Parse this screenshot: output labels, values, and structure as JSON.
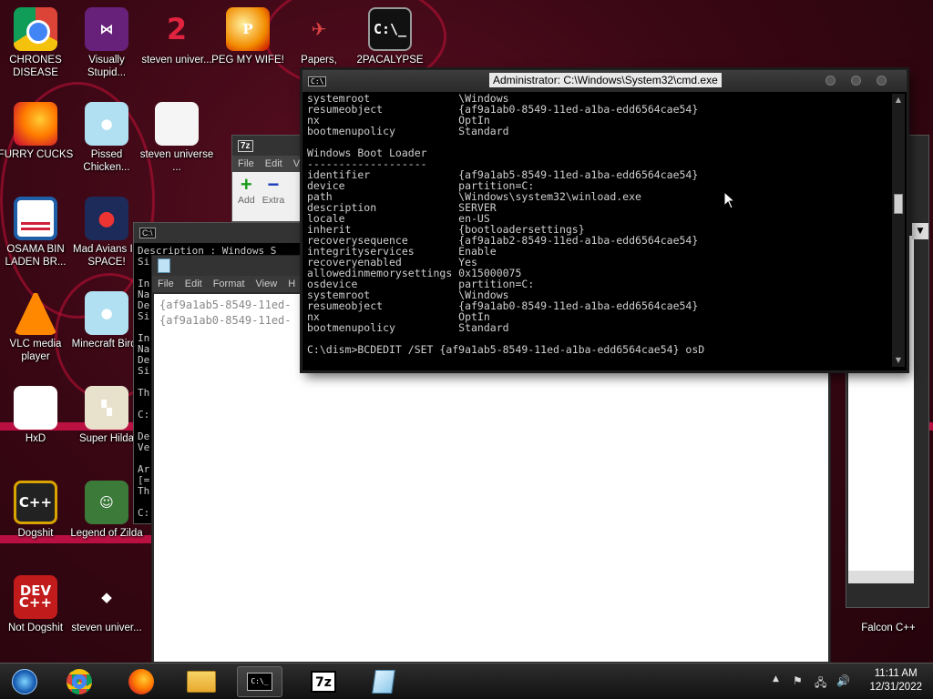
{
  "desktop_icons": [
    {
      "label": "CHRONES DISEASE",
      "icon": "chrome-icon"
    },
    {
      "label": "Visually Stupid...",
      "icon": "visual-studio-icon"
    },
    {
      "label": "steven univer...",
      "icon": "steven-universe-icon"
    },
    {
      "label": "PEG MY WIFE!",
      "icon": "p-icon"
    },
    {
      "label": "Papers,",
      "icon": "papers-please-icon"
    },
    {
      "label": "2PACALYPSE",
      "icon": "cmd-icon"
    },
    {
      "label": "FURRY CUCKS",
      "icon": "firefox-icon"
    },
    {
      "label": "Pissed Chicken...",
      "icon": "angry-birds-seasons-icon"
    },
    {
      "label": "steven universe ...",
      "icon": "document-icon"
    },
    {
      "label": "OSAMA BIN LADEN BR...",
      "icon": "obama-logo-icon"
    },
    {
      "label": "Mad Avians IN SPACE!",
      "icon": "angry-birds-space-icon"
    },
    {
      "label": "VLC media player",
      "icon": "vlc-icon"
    },
    {
      "label": "Minecraft Birds",
      "icon": "angry-birds-icon"
    },
    {
      "label": "HxD",
      "icon": "hxd-icon"
    },
    {
      "label": "Super Hilda",
      "icon": "pixel-art-icon"
    },
    {
      "label": "Dogshit",
      "icon": "dogshit-icon"
    },
    {
      "label": "Legend of Zilda",
      "icon": "zilda-icon"
    },
    {
      "label": "Not Dogshit",
      "icon": "devcpp-icon"
    },
    {
      "label": "steven univer...",
      "icon": "gem-icon"
    },
    {
      "label": "Falcon C++",
      "icon": "falcon-icon"
    }
  ],
  "cmd_window": {
    "title": "Administrator: C:\\Windows\\System32\\cmd.exe",
    "lines": [
      "systemroot              \\Windows",
      "resumeobject            {af9a1ab0-8549-11ed-a1ba-edd6564cae54}",
      "nx                      OptIn",
      "bootmenupolicy          Standard",
      "",
      "Windows Boot Loader",
      "-------------------",
      "identifier              {af9a1ab5-8549-11ed-a1ba-edd6564cae54}",
      "device                  partition=C:",
      "path                    \\Windows\\system32\\winload.exe",
      "description             SERVER",
      "locale                  en-US",
      "inherit                 {bootloadersettings}",
      "recoverysequence        {af9a1ab2-8549-11ed-a1ba-edd6564cae54}",
      "integrityservices       Enable",
      "recoveryenabled         Yes",
      "allowedinmemorysettings 0x15000075",
      "osdevice                partition=C:",
      "systemroot              \\Windows",
      "resumeobject            {af9a1ab0-8549-11ed-a1ba-edd6564cae54}",
      "nx                      OptIn",
      "bootmenupolicy          Standard",
      "",
      "C:\\dism>BCDEDIT /SET {af9a1ab5-8549-11ed-a1ba-edd6564cae54} osD"
    ]
  },
  "sevenzip_window": {
    "menu": [
      "File",
      "Edit",
      "V"
    ],
    "toolbar": [
      "Add",
      "Extra"
    ]
  },
  "notepad_window": {
    "menu": [
      "File",
      "Edit",
      "Format",
      "View",
      "H"
    ],
    "lines": [
      "{af9a1ab5-8549-11ed-",
      "{af9a1ab0-8549-11ed-"
    ]
  },
  "info_window": {
    "lines": [
      "Description : Windows S",
      "Si",
      "",
      "In",
      "Na",
      "De",
      "Si",
      "",
      "In",
      "Na",
      "De",
      "Si",
      "",
      "Th",
      "",
      "C:",
      "",
      "De",
      "Ve",
      "",
      "Ar",
      "[=",
      "Th",
      "",
      "C:"
    ]
  },
  "taskbar": {
    "time": "11:11 AM",
    "date": "12/31/2022",
    "apps": [
      "windows-orb-icon",
      "chrome-icon",
      "firefox-icon",
      "file-explorer-icon",
      "cmd-icon",
      "7zip-icon",
      "notepad-icon"
    ]
  }
}
